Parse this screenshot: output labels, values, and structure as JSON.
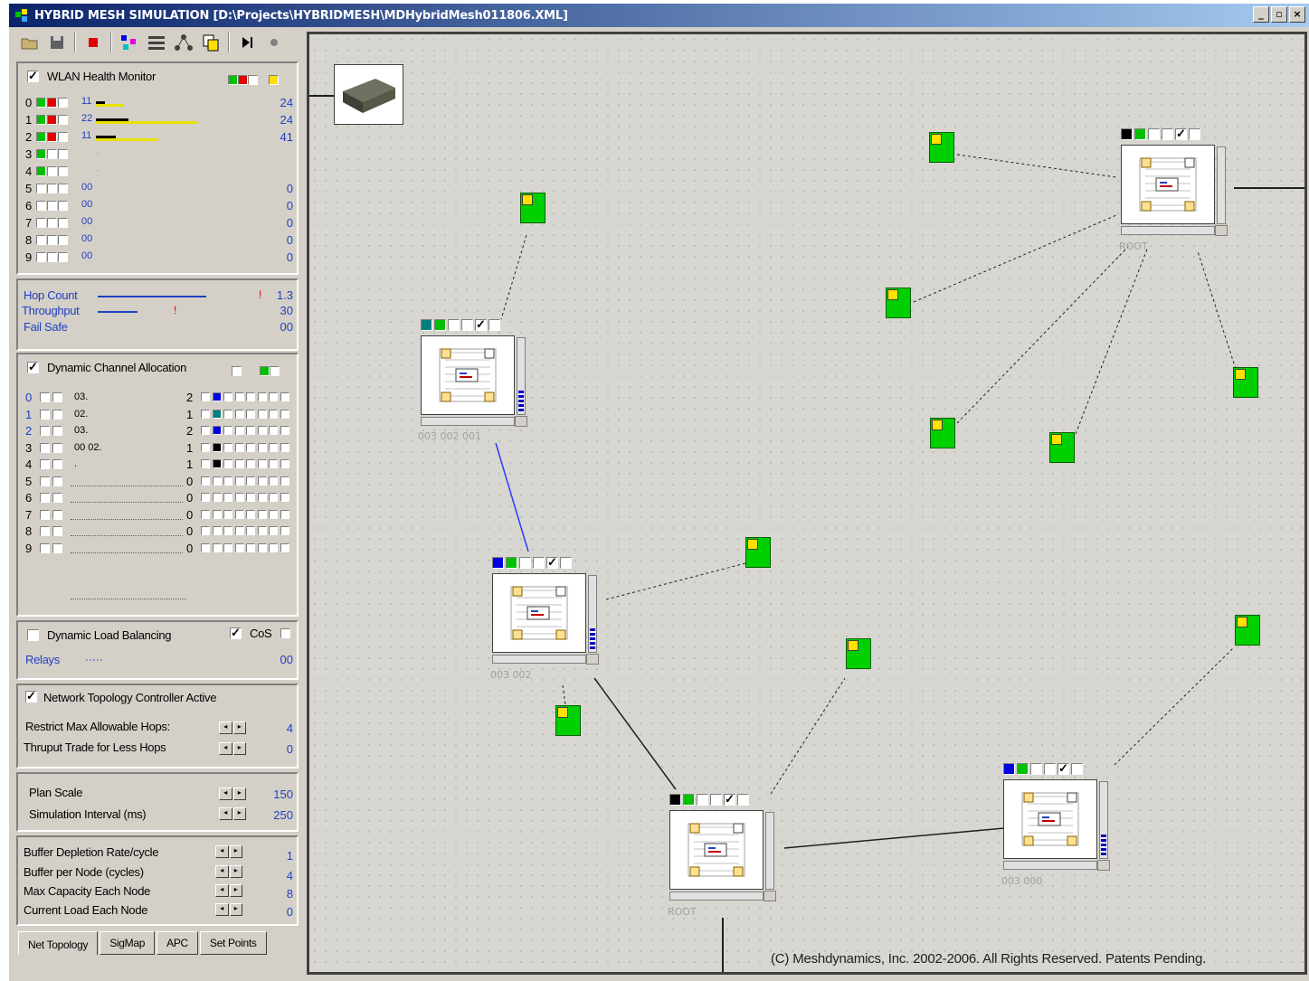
{
  "window": {
    "title": "HYBRID MESH SIMULATION  [D:\\Projects\\HYBRIDMESH\\MDHybridMesh011806.XML]",
    "buttons": [
      "_",
      "▫",
      "×"
    ]
  },
  "health_monitor": {
    "label": "WLAN Health Monitor",
    "checked": true,
    "rows": [
      {
        "idx": "0",
        "left": "11",
        "right": "24",
        "bar": 0.28
      },
      {
        "idx": "1",
        "left": "22",
        "right": "24",
        "bar": 1.0
      },
      {
        "idx": "2",
        "left": "11",
        "right": "41",
        "bar": 0.62
      },
      {
        "idx": "3",
        "left": "",
        "right": ""
      },
      {
        "idx": "4",
        "left": "",
        "right": ""
      },
      {
        "idx": "5",
        "left": "00",
        "right": "0"
      },
      {
        "idx": "6",
        "left": "00",
        "right": "0"
      },
      {
        "idx": "7",
        "left": "00",
        "right": "0"
      },
      {
        "idx": "8",
        "left": "00",
        "right": "0"
      },
      {
        "idx": "9",
        "left": "00",
        "right": "0"
      }
    ]
  },
  "stats": {
    "hop_count_label": "Hop Count",
    "hop_count_value": "1.3",
    "throughput_label": "Throughput",
    "throughput_value": "30",
    "fail_safe_label": "Fail Safe",
    "fail_safe_value": "00"
  },
  "channel_allocation": {
    "label": "Dynamic Channel Allocation",
    "rows": [
      {
        "idx": "0",
        "text": "03.",
        "n": "2"
      },
      {
        "idx": "1",
        "text": "02.",
        "n": "1"
      },
      {
        "idx": "2",
        "text": "03.",
        "n": "2"
      },
      {
        "idx": "3",
        "text": "00 02.",
        "n": "1"
      },
      {
        "idx": "4",
        "text": ".",
        "n": "1"
      },
      {
        "idx": "5",
        "text": "",
        "n": "0"
      },
      {
        "idx": "6",
        "text": "",
        "n": "0"
      },
      {
        "idx": "7",
        "text": "",
        "n": "0"
      },
      {
        "idx": "8",
        "text": "",
        "n": "0"
      },
      {
        "idx": "9",
        "text": "",
        "n": "0"
      }
    ]
  },
  "load_balancing": {
    "label": "Dynamic Load Balancing",
    "cos_label": "CoS",
    "relays_label": "Relays",
    "relays_value": "00"
  },
  "topology_controller": {
    "label": "Network Topology Controller Active",
    "max_hops_label": "Restrict Max Allowable Hops:",
    "max_hops_value": "4",
    "thruput_label": "Thruput Trade for Less Hops",
    "thruput_value": "0"
  },
  "plan": {
    "scale_label": "Plan Scale",
    "scale_value": "150",
    "interval_label": "Simulation Interval (ms)",
    "interval_value": "250"
  },
  "buffers": {
    "depletion_label": "Buffer Depletion Rate/cycle",
    "depletion_value": "1",
    "per_node_label": "Buffer per Node (cycles)",
    "per_node_value": "4",
    "max_capacity_label": "Max Capacity Each Node",
    "max_capacity_value": "8",
    "current_load_label": "Current Load Each Node",
    "current_load_value": "0"
  },
  "tabs": [
    "Net Topology",
    "SigMap",
    "APC",
    "Set Points"
  ],
  "canvas": {
    "node_labels": {
      "root_top": "ROOT",
      "n003_002_001": "003 002 001",
      "n003_002": "003 002",
      "root_bottom": "ROOT",
      "n003_000": "003 000"
    },
    "copyright": "(C) Meshdynamics, Inc. 2002-2006. All Rights Reserved. Patents Pending."
  },
  "colors": {
    "title_bar": "#0a246a",
    "client_green": "#00d000",
    "client_yellow": "#ffe000",
    "link_blue": "#2a3cff"
  }
}
